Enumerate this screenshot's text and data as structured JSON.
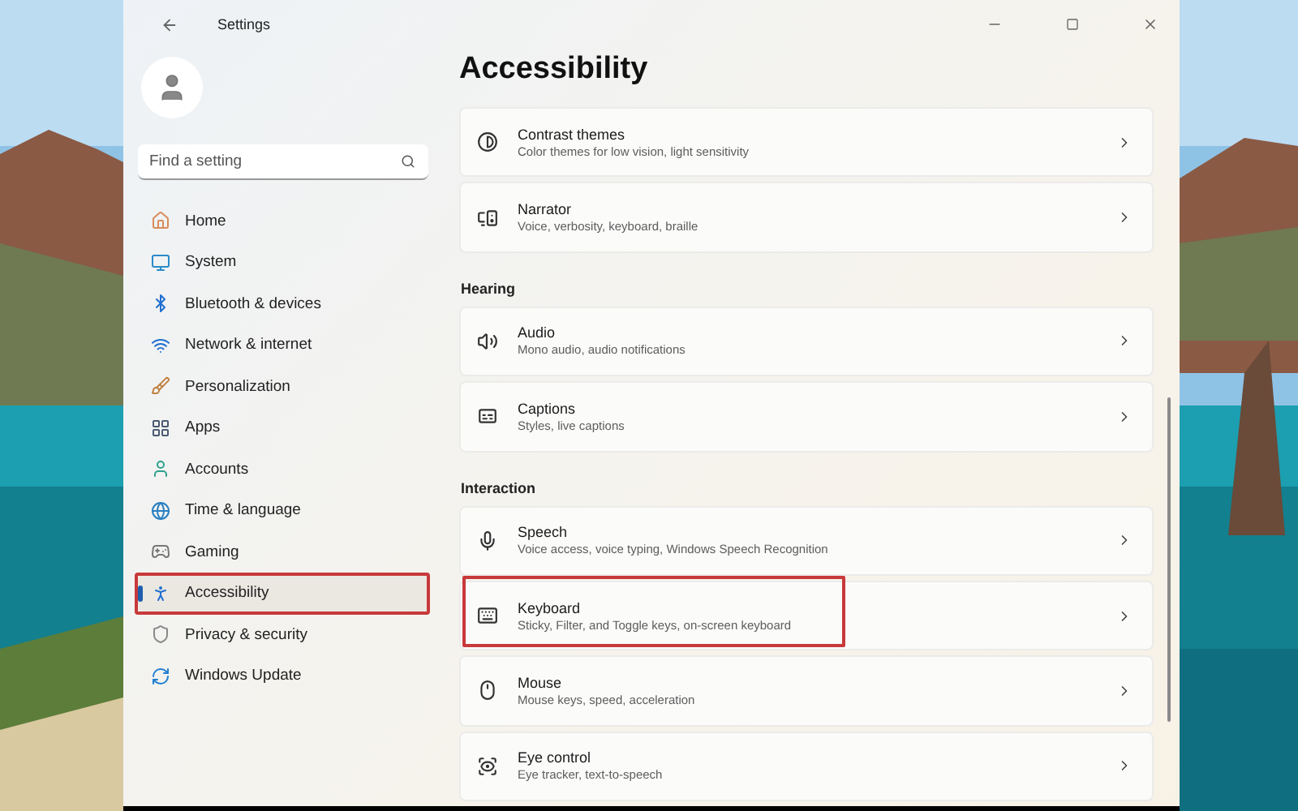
{
  "window": {
    "title": "Settings"
  },
  "sidebar": {
    "search": {
      "placeholder": "Find a setting"
    },
    "items": [
      {
        "label": "Home",
        "selected": false,
        "highlighted": false
      },
      {
        "label": "System",
        "selected": false,
        "highlighted": false
      },
      {
        "label": "Bluetooth & devices",
        "selected": false,
        "highlighted": false
      },
      {
        "label": "Network & internet",
        "selected": false,
        "highlighted": false
      },
      {
        "label": "Personalization",
        "selected": false,
        "highlighted": false
      },
      {
        "label": "Apps",
        "selected": false,
        "highlighted": false
      },
      {
        "label": "Accounts",
        "selected": false,
        "highlighted": false
      },
      {
        "label": "Time & language",
        "selected": false,
        "highlighted": false
      },
      {
        "label": "Gaming",
        "selected": false,
        "highlighted": false
      },
      {
        "label": "Accessibility",
        "selected": true,
        "highlighted": true
      },
      {
        "label": "Privacy & security",
        "selected": false,
        "highlighted": false
      },
      {
        "label": "Windows Update",
        "selected": false,
        "highlighted": false
      }
    ]
  },
  "page": {
    "title": "Accessibility",
    "sections": [
      {
        "items": [
          {
            "title": "Contrast themes",
            "description": "Color themes for low vision, light sensitivity",
            "highlighted": false
          },
          {
            "title": "Narrator",
            "description": "Voice, verbosity, keyboard, braille",
            "highlighted": false
          }
        ]
      },
      {
        "heading": "Hearing",
        "items": [
          {
            "title": "Audio",
            "description": "Mono audio, audio notifications",
            "highlighted": false
          },
          {
            "title": "Captions",
            "description": "Styles, live captions",
            "highlighted": false
          }
        ]
      },
      {
        "heading": "Interaction",
        "items": [
          {
            "title": "Speech",
            "description": "Voice access, voice typing, Windows Speech Recognition",
            "highlighted": false
          },
          {
            "title": "Keyboard",
            "description": "Sticky, Filter, and Toggle keys, on-screen keyboard",
            "highlighted": true
          },
          {
            "title": "Mouse",
            "description": "Mouse keys, speed, acceleration",
            "highlighted": false
          },
          {
            "title": "Eye control",
            "description": "Eye tracker, text-to-speech",
            "highlighted": false
          }
        ]
      }
    ]
  }
}
